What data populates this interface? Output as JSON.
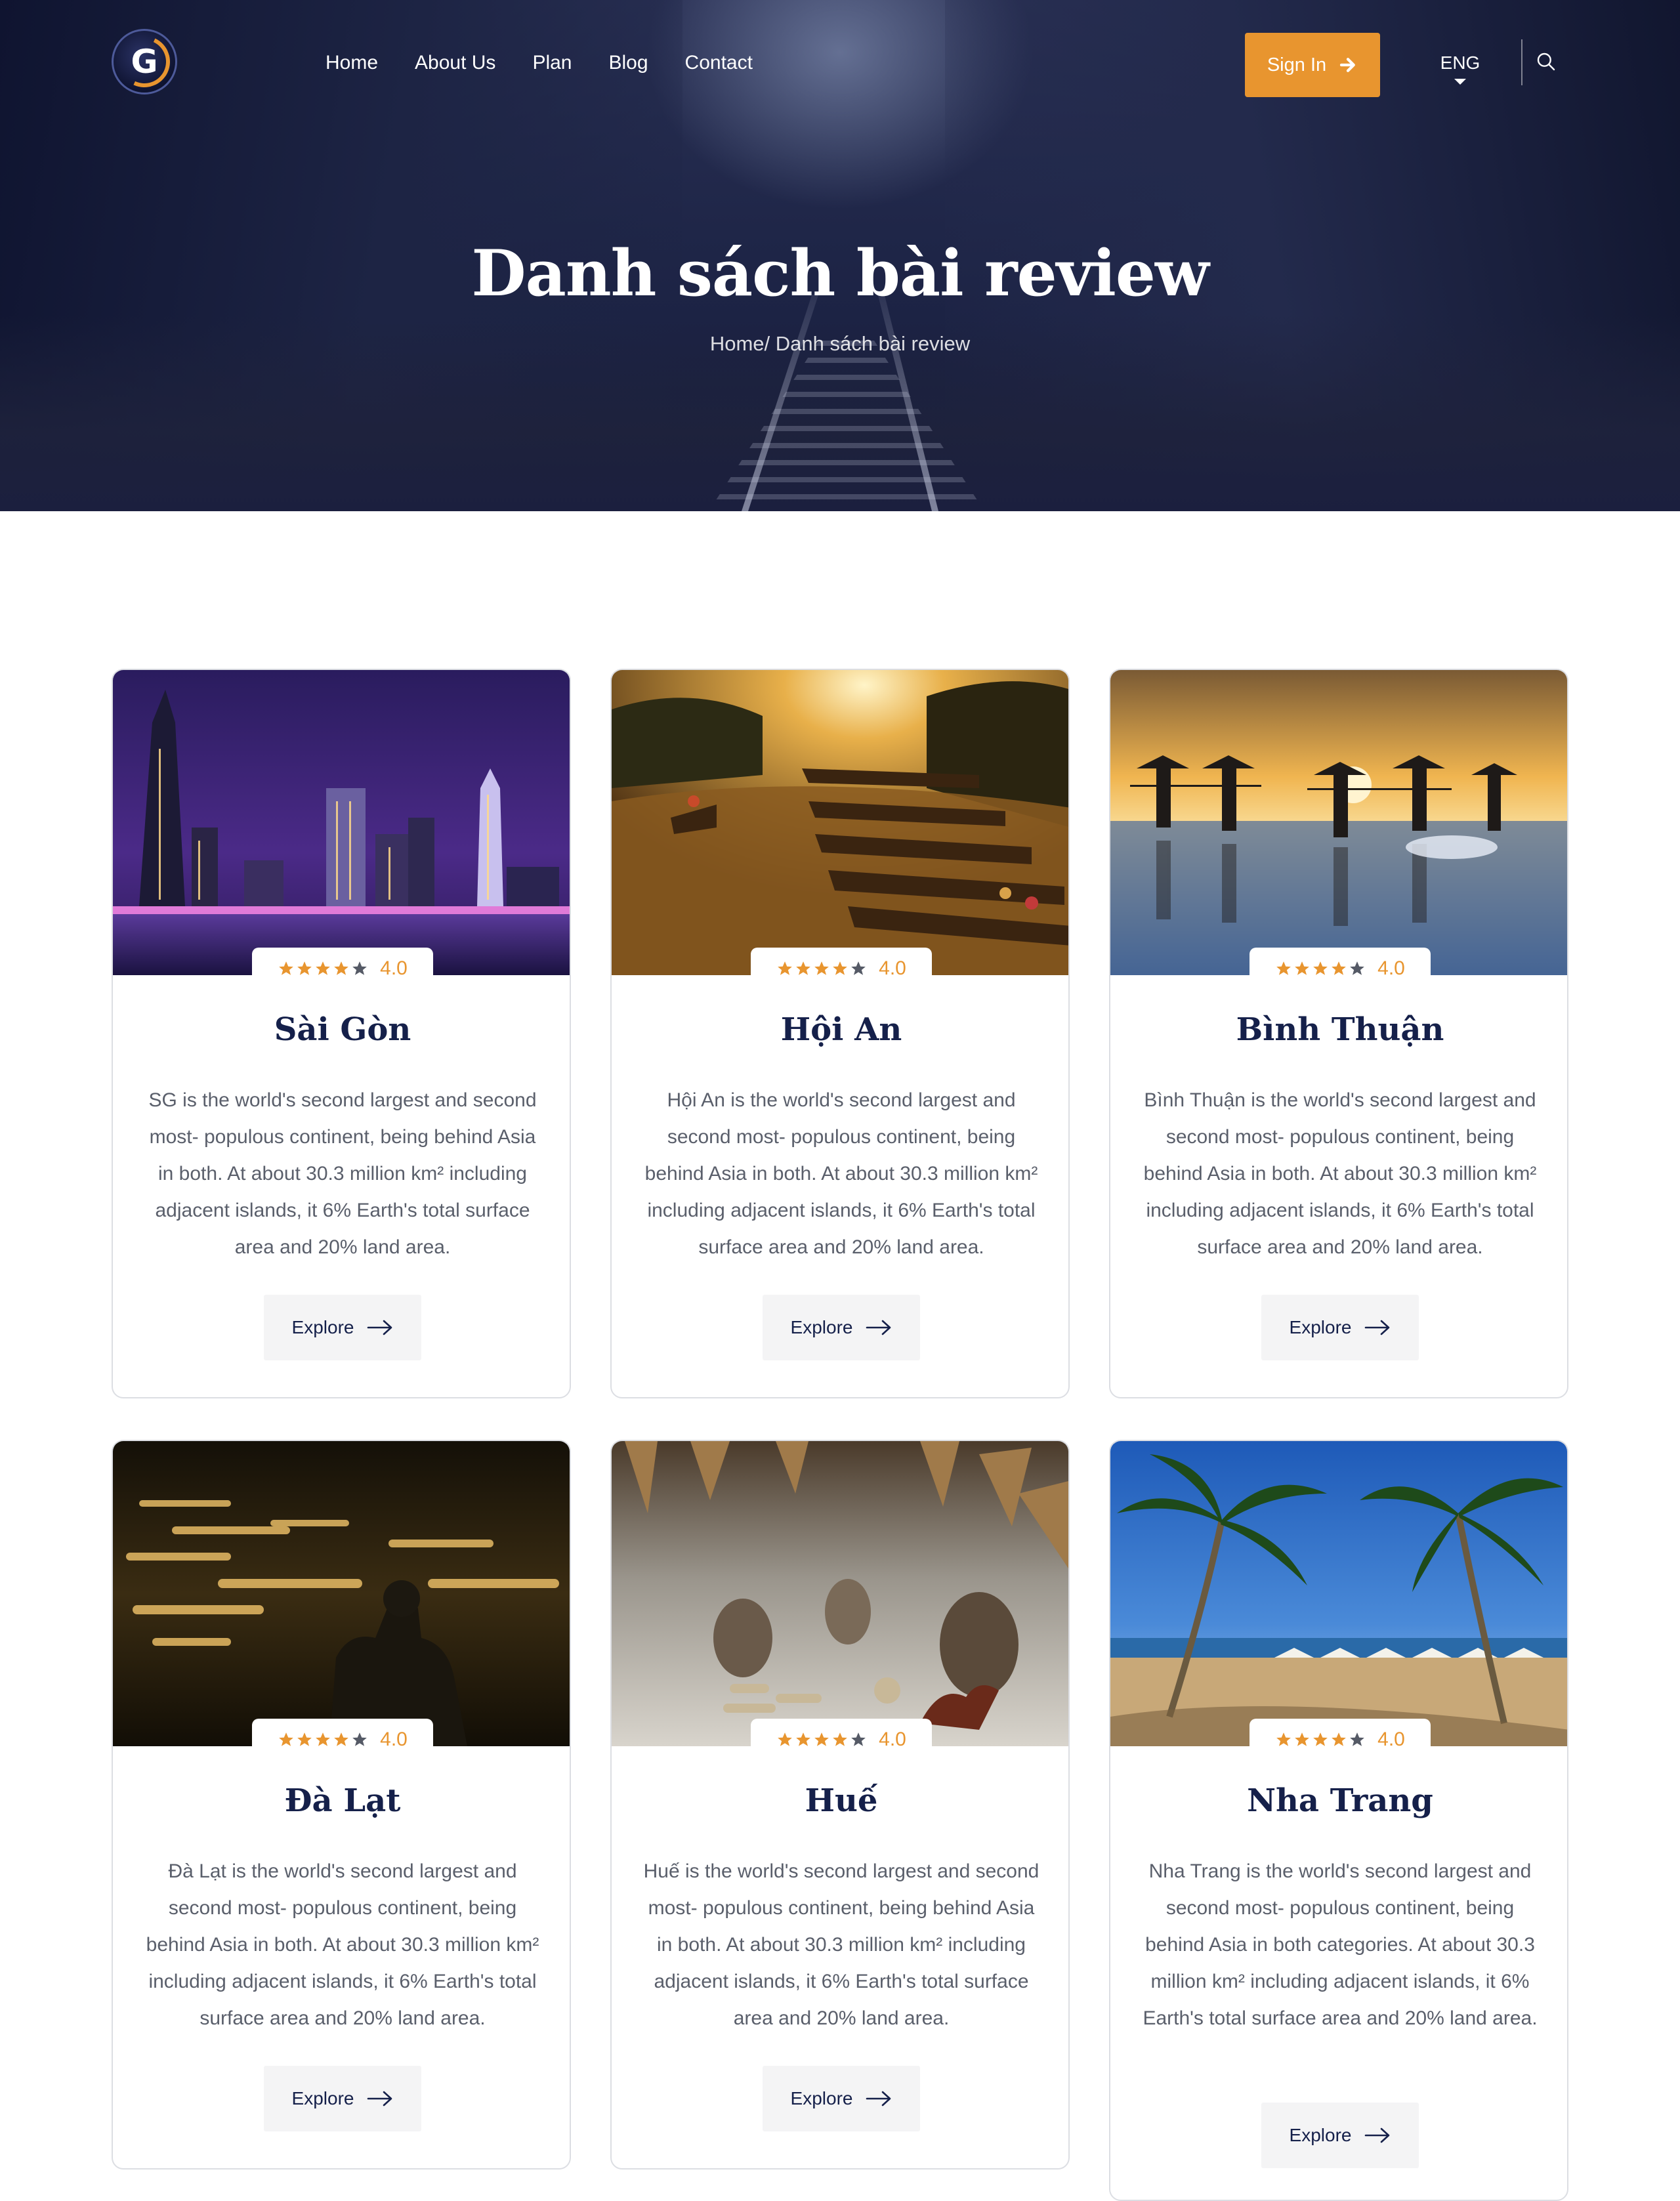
{
  "nav": {
    "logo_letter": "G",
    "menu": [
      "Home",
      "About Us",
      "Plan",
      "Blog",
      "Contact"
    ],
    "signin_label": "Sign In",
    "language": "ENG"
  },
  "hero": {
    "title": "Danh sách bài review",
    "breadcrumb": "Home/ Danh sách bài review"
  },
  "colors": {
    "accent": "#e8952f",
    "navy": "#15204a",
    "hero_bg": "#1f2648"
  },
  "cards": [
    {
      "title": "Sài Gòn",
      "rating": "4.0",
      "stars_filled": 4,
      "description": "SG is the world's second largest and second most- populous continent, being behind Asia in both. At about 30.3 million km² including adjacent islands, it 6% Earth's total surface area and 20% land area.",
      "button": "Explore"
    },
    {
      "title": "Hội An",
      "rating": "4.0",
      "stars_filled": 4,
      "description": "Hội An is the world's second largest and second most- populous continent, being behind Asia in both. At about 30.3 million km² including adjacent islands, it 6% Earth's total surface area and 20% land area.",
      "button": "Explore"
    },
    {
      "title": "Bình Thuận",
      "rating": "4.0",
      "stars_filled": 4,
      "description": "Bình Thuận is the world's second largest and second most- populous continent, being behind Asia in both. At about 30.3 million km² including adjacent islands, it 6% Earth's total surface area and 20% land area.",
      "button": "Explore"
    },
    {
      "title": "Đà Lạt",
      "rating": "4.0",
      "stars_filled": 4,
      "description": "Đà Lạt is the world's second largest and second most- populous continent, being behind Asia in both. At about 30.3 million km² including adjacent islands, it 6% Earth's total surface area and 20% land area.",
      "button": "Explore"
    },
    {
      "title": "Huế",
      "rating": "4.0",
      "stars_filled": 4,
      "description": "Huế is the world's second largest and second most- populous continent, being behind Asia in both. At about 30.3 million km² including adjacent islands, it 6% Earth's total surface area and 20% land area.",
      "button": "Explore"
    },
    {
      "title": "Nha Trang",
      "rating": "4.0",
      "stars_filled": 4,
      "description": "Nha Trang is the world's second largest and second most- populous continent, being behind Asia in both categories. At about 30.3 million km² including adjacent islands, it 6% Earth's total surface area and 20% land area.",
      "button": "Explore"
    }
  ]
}
